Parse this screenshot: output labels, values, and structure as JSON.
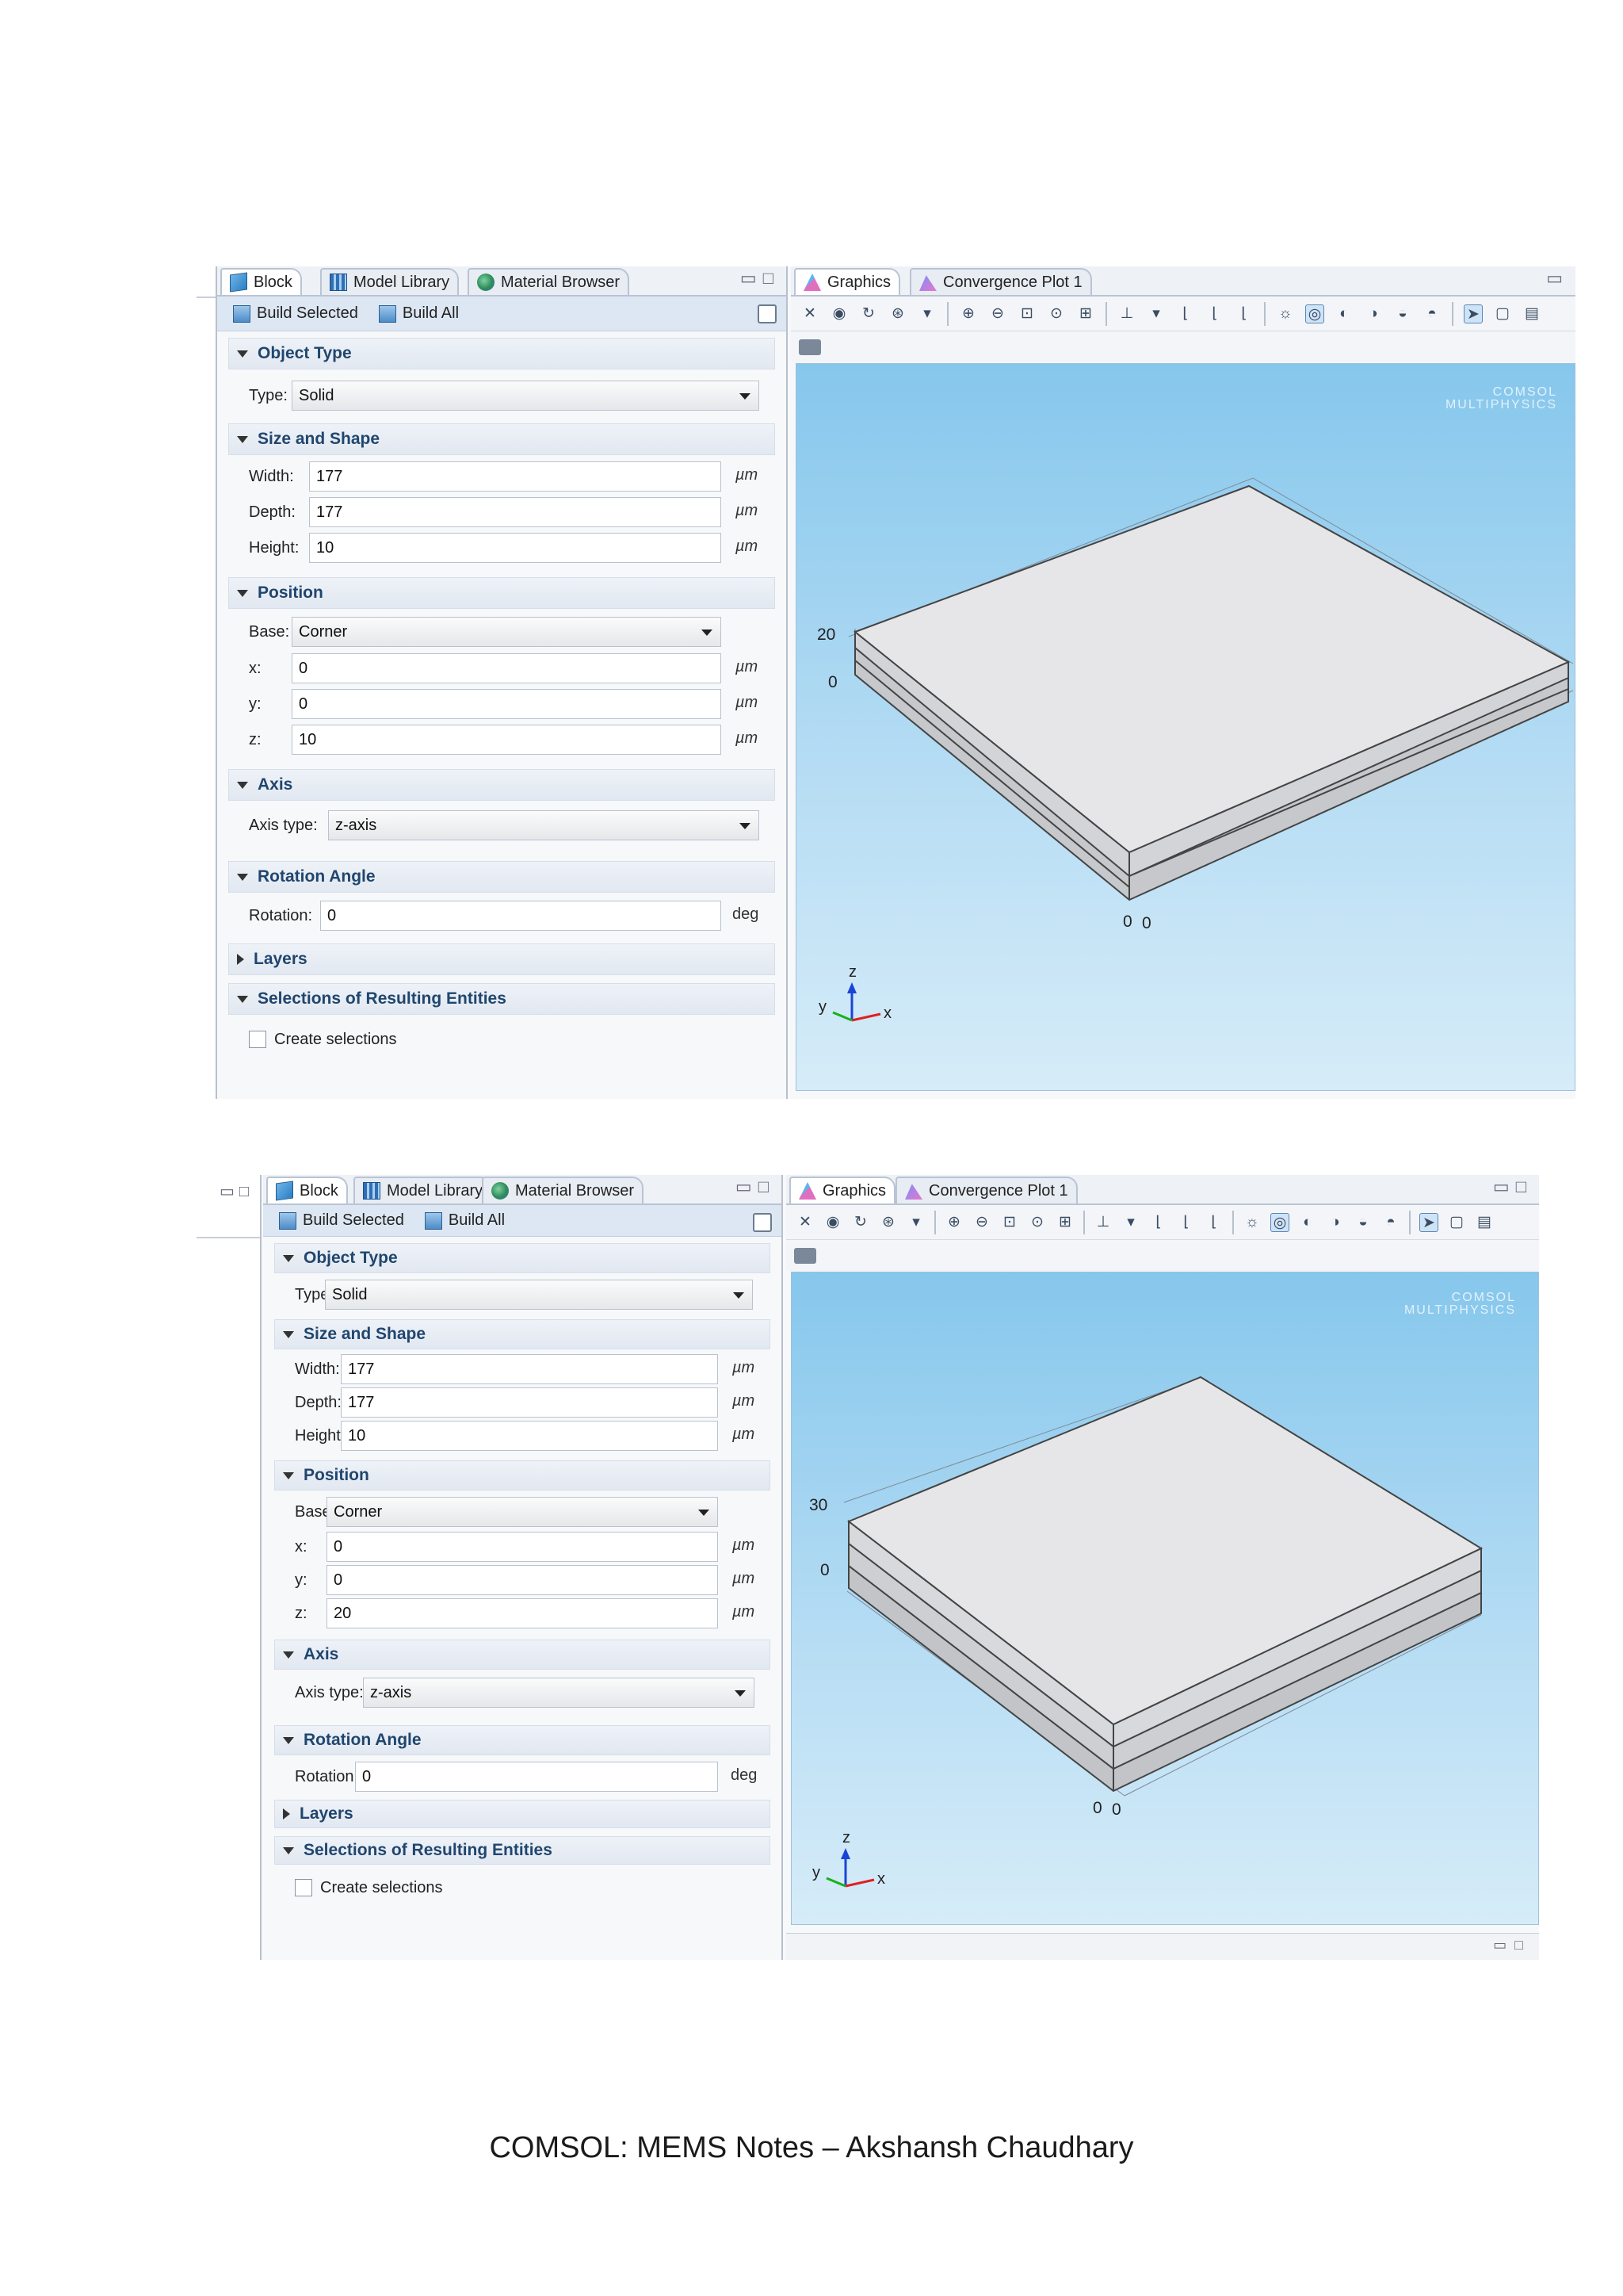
{
  "caption": "COMSOL: MEMS Notes – Akshansh Chaudhary",
  "tabs": {
    "block": "Block",
    "model_library": "Model Library",
    "material_browser": "Material Browser",
    "graphics": "Graphics",
    "convergence_plot": "Convergence Plot 1"
  },
  "toolbar": {
    "build_selected": "Build Selected",
    "build_all": "Build All"
  },
  "sections": {
    "object_type": "Object Type",
    "size_and_shape": "Size and Shape",
    "position": "Position",
    "axis": "Axis",
    "rotation_angle": "Rotation Angle",
    "layers": "Layers",
    "selections": "Selections of Resulting Entities"
  },
  "labels": {
    "type": "Type:",
    "width": "Width:",
    "depth": "Depth:",
    "height": "Height:",
    "base": "Base:",
    "x": "x:",
    "y": "y:",
    "z": "z:",
    "axis_type": "Axis type:",
    "rotation": "Rotation:",
    "create_selections": "Create selections"
  },
  "units": {
    "length": "µm",
    "angle": "deg"
  },
  "brand": {
    "line1": "COMSOL",
    "line2": "MULTIPHYSICS"
  },
  "triad_labels": {
    "x": "x",
    "y": "y",
    "z": "z"
  },
  "screenshots": [
    {
      "type": "Solid",
      "width": "177",
      "depth": "177",
      "height": "10",
      "base": "Corner",
      "x": "0",
      "y": "0",
      "z": "10",
      "axis_type": "z-axis",
      "rotation": "0",
      "create_selections_checked": false,
      "graphics_axis_labels": {
        "top": "20",
        "bottom": "0",
        "origin_a": "0",
        "origin_b": "0"
      },
      "layer_count": 2
    },
    {
      "type": "Solid",
      "width": "177",
      "depth": "177",
      "height": "10",
      "base": "Corner",
      "x": "0",
      "y": "0",
      "z": "20",
      "axis_type": "z-axis",
      "rotation": "0",
      "create_selections_checked": false,
      "graphics_axis_labels": {
        "top": "30",
        "bottom": "0",
        "origin_a": "0",
        "origin_b": "0"
      },
      "layer_count": 3
    }
  ]
}
